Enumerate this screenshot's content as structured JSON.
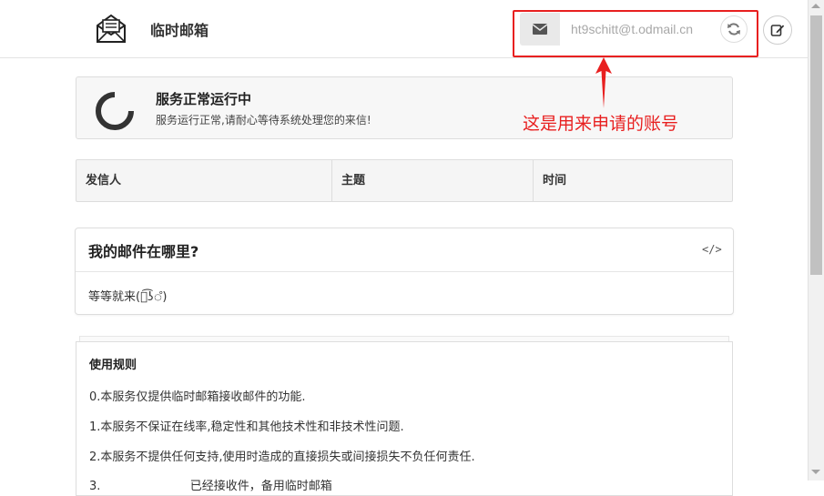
{
  "header": {
    "brand": "临时邮箱",
    "email": {
      "value": "",
      "placeholder": "ht9schitt@t.odmail.cn"
    },
    "icons": [
      "envelope-open-icon",
      "envelope-icon",
      "refresh-icon",
      "edit-icon"
    ]
  },
  "status": {
    "title": "服务正常运行中",
    "description": "服务运行正常,请耐心等待系统处理您的来信!"
  },
  "annotation": {
    "text": "这是用来申请的账号",
    "color": "#e82020"
  },
  "mail_table": {
    "columns": [
      "发信人",
      "主题",
      "时间"
    ]
  },
  "where_panel": {
    "title": "我的邮件在哪里?",
    "code_icon": "</>",
    "body": "等等就来(ஂ͡ʖஂ)"
  },
  "rules": {
    "title": "使用规则",
    "items": [
      "0.本服务仅提供临时邮箱接收邮件的功能.",
      "1.本服务不保证在线率,稳定性和其他技术性和非技术性问题.",
      "2.本服务不提供任何支持,使用时造成的直接损失或间接损失不负任何责任."
    ],
    "partial_item": {
      "prefix": "3.",
      "middle": "已经接收件，备用临时邮箱"
    }
  }
}
